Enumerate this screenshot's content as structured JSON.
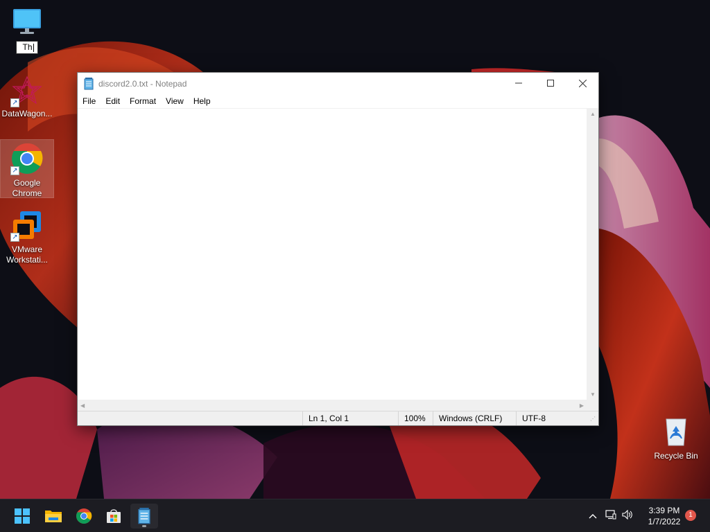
{
  "desktop": {
    "icons": [
      {
        "label": ""
      },
      {
        "label": "DataWagon..."
      },
      {
        "label": "Google Chrome"
      },
      {
        "label": "VMware Workstati..."
      },
      {
        "label": "Recycle Bin"
      }
    ],
    "rename_value": "Th"
  },
  "notepad": {
    "title": "discord2.0.txt - Notepad",
    "menu": [
      "File",
      "Edit",
      "Format",
      "View",
      "Help"
    ],
    "content": "",
    "status": {
      "position": "Ln 1, Col 1",
      "zoom": "100%",
      "line_endings": "Windows (CRLF)",
      "encoding": "UTF-8"
    }
  },
  "taskbar": {
    "apps": [
      {
        "name": "start-icon"
      },
      {
        "name": "file-explorer-icon"
      },
      {
        "name": "chrome-icon"
      },
      {
        "name": "microsoft-store-icon"
      },
      {
        "name": "notepad-icon"
      }
    ],
    "clock_time": "3:39 PM",
    "clock_date": "1/7/2022",
    "notification_count": "1"
  },
  "colors": {
    "accent": "#0078d4",
    "wallpaper_base": "#0d0e16",
    "wallpaper_red": "#d2361b",
    "taskbar": "#1c1c22"
  }
}
